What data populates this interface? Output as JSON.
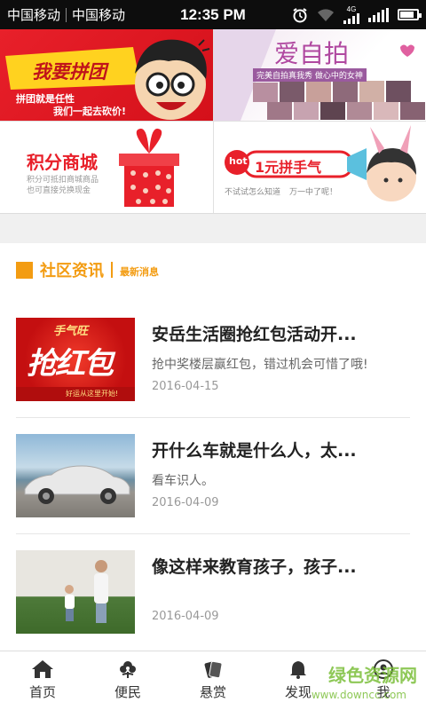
{
  "status": {
    "carrier1": "中国移动",
    "carrier2": "中国移动",
    "time": "12:35 PM",
    "network": "4G"
  },
  "banners": [
    {
      "title": "我要拼团",
      "line1": "拼团就是任性",
      "line2": "我们一起去砍价!"
    },
    {
      "title": "爱自拍",
      "subtitle": "完美自拍真我秀 做心中的女神"
    },
    {
      "title": "积分商城",
      "line1": "积分可抵扣商城商品",
      "line2": "也可直接兑换现金"
    },
    {
      "badge": "hot",
      "title": "1元拼手气",
      "line1": "不试试怎么知道",
      "line2": "万一中了呢！"
    }
  ],
  "section": {
    "title": "社区资讯",
    "subtitle": "最新消息"
  },
  "news": [
    {
      "title": "安岳生活圈抢红包活动开...",
      "desc": "抢中奖楼层赢红包，错过机会可惜了哦!",
      "date": "2016-04-15",
      "thumb_title": "手气旺",
      "thumb_big": "抢红包",
      "thumb_foot": "好运从这里开始!"
    },
    {
      "title": "开什么车就是什么人，太...",
      "desc": "看车识人。",
      "date": "2016-04-09"
    },
    {
      "title": "像这样来教育孩子，孩子...",
      "desc": "",
      "date": "2016-04-09"
    }
  ],
  "tabs": [
    {
      "label": "首页",
      "icon": "home-icon"
    },
    {
      "label": "便民",
      "icon": "flower-icon"
    },
    {
      "label": "悬赏",
      "icon": "cards-icon"
    },
    {
      "label": "发现",
      "icon": "bell-icon"
    },
    {
      "label": "我",
      "icon": "user-icon"
    }
  ],
  "watermark": {
    "text": "绿色资源网",
    "url": "www.downcc.com"
  },
  "colors": {
    "accent": "#f39c12",
    "status_bg": "#0d0d0d",
    "red": "#e8202a"
  }
}
